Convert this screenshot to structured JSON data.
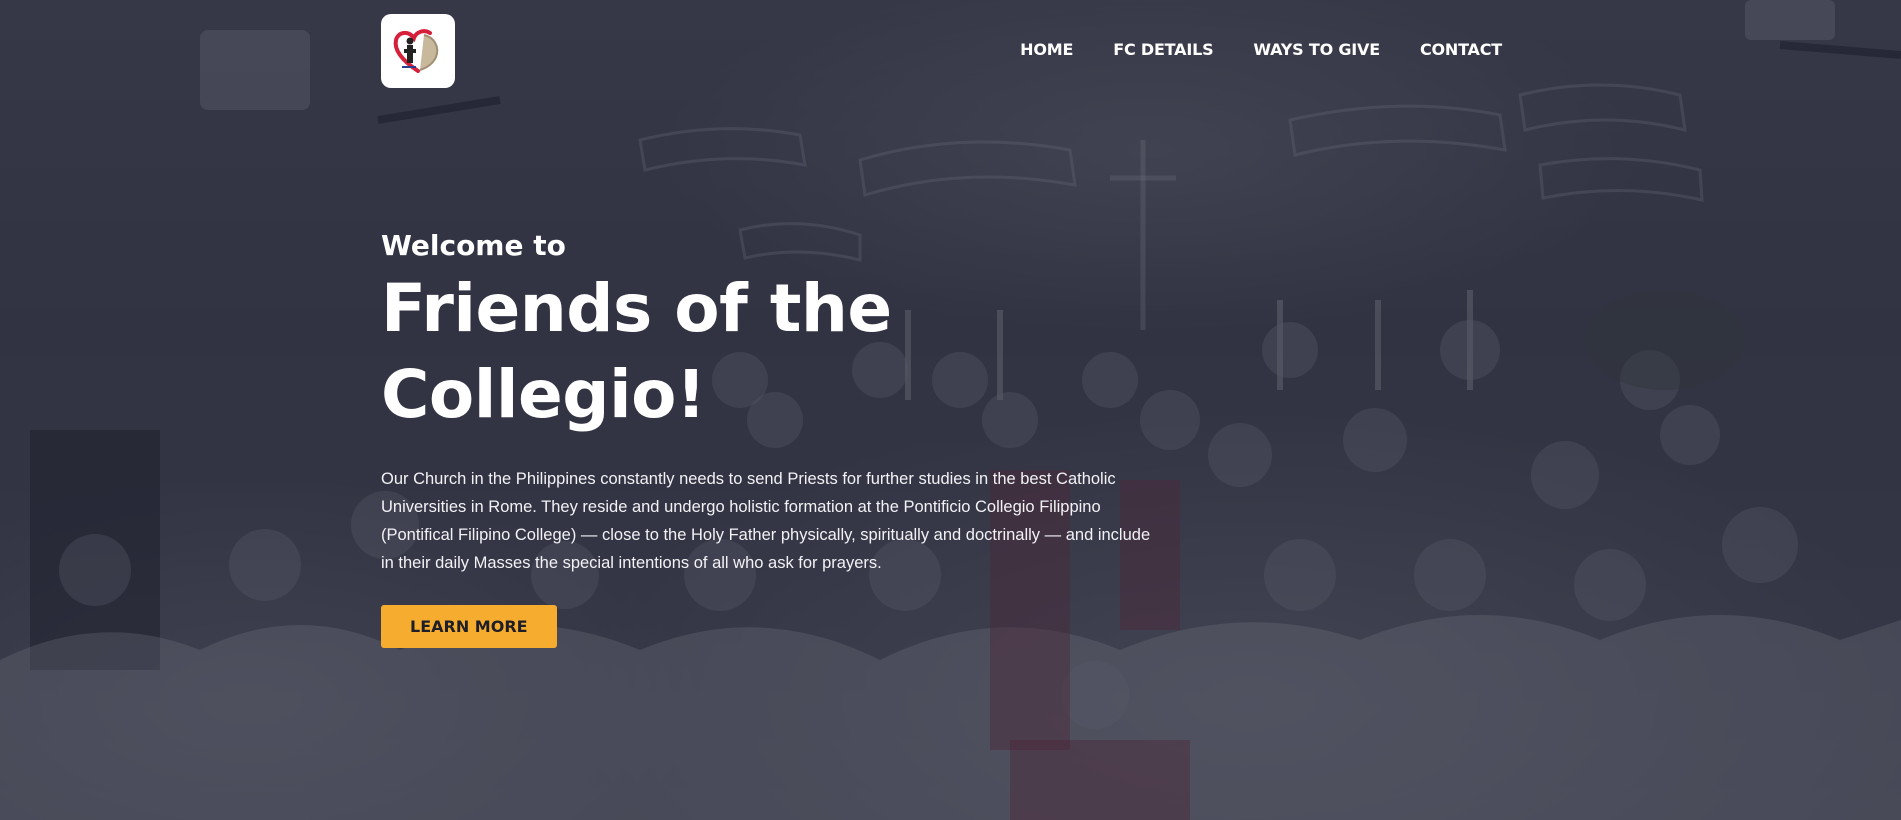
{
  "nav": {
    "items": [
      {
        "label": "HOME"
      },
      {
        "label": "FC DETAILS"
      },
      {
        "label": "WAYS TO GIVE"
      },
      {
        "label": "CONTACT"
      }
    ]
  },
  "logo": {
    "icon": "friends-of-collegio-logo"
  },
  "hero": {
    "welcome": "Welcome to",
    "title": "Friends of the Collegio!",
    "description": "Our Church in the Philippines constantly needs to send Priests for further studies in the best Catholic Universities in Rome. They reside and undergo holistic formation at the Pontificio Collegio Filippino (Pontifical Filipino College) — close to the Holy Father physically, spiritually and doctrinally — and include in their daily Masses the special intentions of all who ask for prayers.",
    "button_label": "LEARN MORE"
  },
  "colors": {
    "accent": "#f6ad2f",
    "overlay": "#26283a",
    "text": "#ffffff"
  }
}
